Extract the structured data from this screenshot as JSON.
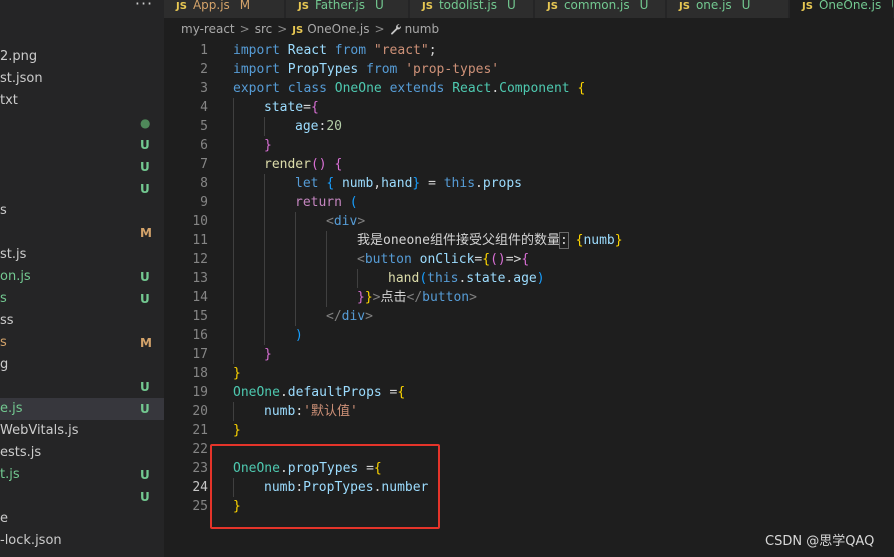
{
  "tabs": [
    {
      "name": "App.js",
      "status": "M",
      "active": false,
      "kind": "mod"
    },
    {
      "name": "Father.js",
      "status": "U",
      "active": false,
      "kind": "unt"
    },
    {
      "name": "todolist.js",
      "status": "U",
      "active": false,
      "kind": "unt"
    },
    {
      "name": "common.js",
      "status": "U",
      "active": false,
      "kind": "unt"
    },
    {
      "name": "one.js",
      "status": "U",
      "active": false,
      "kind": "unt"
    },
    {
      "name": "OneOne.js",
      "status": "U",
      "active": true,
      "kind": "unt"
    }
  ],
  "tab_icon_label": "JS",
  "more_actions": "···",
  "explorer": [
    {
      "name": "2.png",
      "status": "",
      "kind": "plain"
    },
    {
      "name": "st.json",
      "status": "",
      "kind": "plain"
    },
    {
      "name": "txt",
      "status": "",
      "kind": "plain"
    },
    {
      "name": "",
      "status": "●",
      "kind": "dot"
    },
    {
      "name": "",
      "status": "U",
      "kind": "unt"
    },
    {
      "name": "",
      "status": "U",
      "kind": "unt"
    },
    {
      "name": "",
      "status": "U",
      "kind": "unt"
    },
    {
      "name": "s",
      "status": "",
      "kind": "plain"
    },
    {
      "name": "",
      "status": "M",
      "kind": "mod"
    },
    {
      "name": "st.js",
      "status": "",
      "kind": "plain"
    },
    {
      "name": "on.js",
      "status": "U",
      "kind": "unt"
    },
    {
      "name": "s",
      "status": "U",
      "kind": "unt"
    },
    {
      "name": "ss",
      "status": "",
      "kind": "plain"
    },
    {
      "name": "s",
      "status": "M",
      "kind": "mod"
    },
    {
      "name": "g",
      "status": "",
      "kind": "plain"
    },
    {
      "name": "",
      "status": "U",
      "kind": "unt"
    },
    {
      "name": "e.js",
      "status": "U",
      "kind": "unt",
      "selected": true
    },
    {
      "name": "WebVitals.js",
      "status": "",
      "kind": "plain"
    },
    {
      "name": "ests.js",
      "status": "",
      "kind": "plain"
    },
    {
      "name": "t.js",
      "status": "U",
      "kind": "unt"
    },
    {
      "name": "",
      "status": "U",
      "kind": "unt"
    },
    {
      "name": "e",
      "status": "",
      "kind": "plain"
    },
    {
      "name": "-lock.json",
      "status": "",
      "kind": "plain"
    }
  ],
  "breadcrumb": {
    "root": "my-react",
    "folder": "src",
    "file": "OneOne.js",
    "symbol": "numb",
    "sep": ">"
  },
  "code": [
    {
      "n": "1",
      "indent": 0,
      "t": [
        [
          "kw",
          "import"
        ],
        [
          "pun",
          " "
        ],
        [
          "var",
          "React"
        ],
        [
          "pun",
          " "
        ],
        [
          "kw",
          "from"
        ],
        [
          "pun",
          " "
        ],
        [
          "str",
          "\"react\""
        ],
        [
          "pun",
          ";"
        ]
      ]
    },
    {
      "n": "2",
      "indent": 0,
      "t": [
        [
          "kw",
          "import"
        ],
        [
          "pun",
          " "
        ],
        [
          "var",
          "PropTypes"
        ],
        [
          "pun",
          " "
        ],
        [
          "kw",
          "from"
        ],
        [
          "pun",
          " "
        ],
        [
          "str",
          "'prop-types'"
        ]
      ]
    },
    {
      "n": "3",
      "indent": 0,
      "t": [
        [
          "kw",
          "export"
        ],
        [
          "pun",
          " "
        ],
        [
          "kw",
          "class"
        ],
        [
          "pun",
          " "
        ],
        [
          "cls",
          "OneOne"
        ],
        [
          "pun",
          " "
        ],
        [
          "kw",
          "extends"
        ],
        [
          "pun",
          " "
        ],
        [
          "cls",
          "React"
        ],
        [
          "pun",
          "."
        ],
        [
          "cls",
          "Component"
        ],
        [
          "pun",
          " "
        ],
        [
          "b1",
          "{"
        ]
      ]
    },
    {
      "n": "4",
      "indent": 1,
      "t": [
        [
          "var",
          "state"
        ],
        [
          "pun",
          "="
        ],
        [
          "b2",
          "{"
        ]
      ]
    },
    {
      "n": "5",
      "indent": 2,
      "t": [
        [
          "var",
          "age"
        ],
        [
          "pun",
          ":"
        ],
        [
          "num",
          "20"
        ]
      ]
    },
    {
      "n": "6",
      "indent": 1,
      "t": [
        [
          "b2",
          "}"
        ]
      ]
    },
    {
      "n": "7",
      "indent": 1,
      "t": [
        [
          "fn",
          "render"
        ],
        [
          "b2",
          "()"
        ],
        [
          "pun",
          " "
        ],
        [
          "b2",
          "{"
        ]
      ]
    },
    {
      "n": "8",
      "indent": 2,
      "t": [
        [
          "kw",
          "let"
        ],
        [
          "pun",
          " "
        ],
        [
          "b3",
          "{"
        ],
        [
          "pun",
          " "
        ],
        [
          "var",
          "numb"
        ],
        [
          "pun",
          ","
        ],
        [
          "var",
          "hand"
        ],
        [
          "b3",
          "}"
        ],
        [
          "pun",
          " = "
        ],
        [
          "kw",
          "this"
        ],
        [
          "pun",
          "."
        ],
        [
          "var",
          "props"
        ]
      ]
    },
    {
      "n": "9",
      "indent": 2,
      "t": [
        [
          "kw2",
          "return"
        ],
        [
          "pun",
          " "
        ],
        [
          "b3",
          "("
        ]
      ]
    },
    {
      "n": "10",
      "indent": 3,
      "t": [
        [
          "tagb",
          "<"
        ],
        [
          "tag",
          "div"
        ],
        [
          "tagb",
          ">"
        ]
      ]
    },
    {
      "n": "11",
      "indent": 4,
      "t": [
        [
          "txt",
          "我是oneone组件接受父组件的数量"
        ],
        [
          "hl",
          ":"
        ],
        [
          "pun",
          " "
        ],
        [
          "b1",
          "{"
        ],
        [
          "var",
          "numb"
        ],
        [
          "b1",
          "}"
        ]
      ]
    },
    {
      "n": "12",
      "indent": 4,
      "t": [
        [
          "tagb",
          "<"
        ],
        [
          "tag",
          "button"
        ],
        [
          "pun",
          " "
        ],
        [
          "var",
          "onClick"
        ],
        [
          "pun",
          "="
        ],
        [
          "b1",
          "{"
        ],
        [
          "b2",
          "()"
        ],
        [
          "pun",
          "=>"
        ],
        [
          "b2",
          "{"
        ]
      ]
    },
    {
      "n": "13",
      "indent": 5,
      "t": [
        [
          "fn",
          "hand"
        ],
        [
          "b3",
          "("
        ],
        [
          "kw",
          "this"
        ],
        [
          "pun",
          "."
        ],
        [
          "var",
          "state"
        ],
        [
          "pun",
          "."
        ],
        [
          "var",
          "age"
        ],
        [
          "b3",
          ")"
        ]
      ]
    },
    {
      "n": "14",
      "indent": 4,
      "t": [
        [
          "b2",
          "}"
        ],
        [
          "b1",
          "}"
        ],
        [
          "tagb",
          ">"
        ],
        [
          "txt",
          "点击"
        ],
        [
          "tagb",
          "</"
        ],
        [
          "tag",
          "button"
        ],
        [
          "tagb",
          ">"
        ]
      ]
    },
    {
      "n": "15",
      "indent": 3,
      "t": [
        [
          "tagb",
          "</"
        ],
        [
          "tag",
          "div"
        ],
        [
          "tagb",
          ">"
        ]
      ]
    },
    {
      "n": "16",
      "indent": 2,
      "t": [
        [
          "b3",
          ")"
        ]
      ]
    },
    {
      "n": "17",
      "indent": 1,
      "t": [
        [
          "b2",
          "}"
        ]
      ]
    },
    {
      "n": "18",
      "indent": 0,
      "t": [
        [
          "b1",
          "}"
        ]
      ]
    },
    {
      "n": "19",
      "indent": 0,
      "t": [
        [
          "cls",
          "OneOne"
        ],
        [
          "pun",
          "."
        ],
        [
          "var",
          "defaultProps"
        ],
        [
          "pun",
          " ="
        ],
        [
          "b1",
          "{"
        ]
      ]
    },
    {
      "n": "20",
      "indent": 1,
      "t": [
        [
          "var",
          "numb"
        ],
        [
          "pun",
          ":"
        ],
        [
          "str",
          "'默认值'"
        ]
      ]
    },
    {
      "n": "21",
      "indent": 0,
      "t": [
        [
          "b1",
          "}"
        ]
      ]
    },
    {
      "n": "22",
      "indent": 0,
      "t": []
    },
    {
      "n": "23",
      "indent": 0,
      "t": [
        [
          "cls",
          "OneOne"
        ],
        [
          "pun",
          "."
        ],
        [
          "var",
          "propTypes"
        ],
        [
          "pun",
          " ="
        ],
        [
          "b1",
          "{"
        ]
      ]
    },
    {
      "n": "24",
      "indent": 1,
      "cur": true,
      "t": [
        [
          "var",
          "numb"
        ],
        [
          "pun",
          ":"
        ],
        [
          "var",
          "PropTypes"
        ],
        [
          "pun",
          "."
        ],
        [
          "var",
          "number"
        ]
      ]
    },
    {
      "n": "25",
      "indent": 0,
      "t": [
        [
          "b1",
          "}"
        ]
      ]
    }
  ],
  "watermark": "CSDN @思学QAQ",
  "colors": {
    "annotation_box": "#e5342a",
    "modified": "#d4a36a",
    "untracked": "#73c991",
    "editor_bg": "#1e1e1e"
  }
}
